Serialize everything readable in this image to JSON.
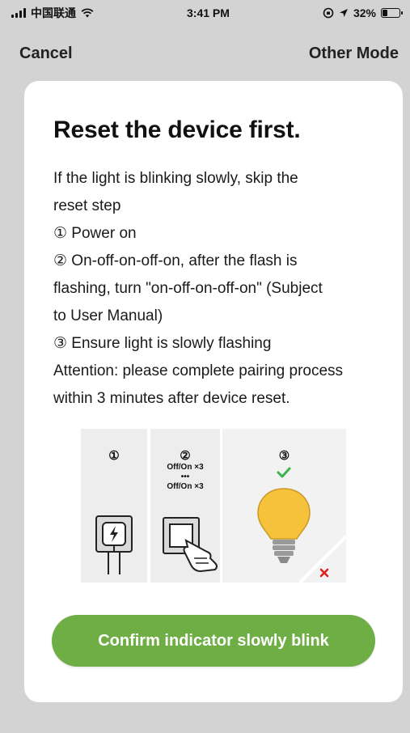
{
  "status_bar": {
    "carrier": "中国联通",
    "time": "3:41 PM",
    "battery_pct": "32%",
    "battery_level": 0.32,
    "icons": [
      "signal-icon",
      "wifi-icon",
      "lock-rotation-icon",
      "location-icon",
      "battery-icon"
    ]
  },
  "nav": {
    "cancel_label": "Cancel",
    "other_mode_label": "Other Mode"
  },
  "card": {
    "title": "Reset the device first.",
    "lines": [
      "If the light is blinking slowly, skip the",
      "reset step",
      "① Power on",
      "② On-off-on-off-on, after the flash is",
      "flashing, turn \"on-off-on-off-on\" (Subject",
      "to User Manual)",
      "③ Ensure  light is slowly flashing",
      "Attention: please complete pairing process",
      "within 3 minutes after device reset."
    ],
    "illustration": {
      "step1": "①",
      "step2": "②",
      "step2_note_1": "Off/On ×3",
      "step2_note_dots": "•••",
      "step2_note_2": "Off/On ×3",
      "step3": "③"
    },
    "confirm_label": "Confirm indicator slowly blink"
  },
  "colors": {
    "accent_green": "#6fae45",
    "bulb_yellow": "#f6c23b",
    "check_green": "#3bb54a",
    "cross_red": "#e02020"
  }
}
